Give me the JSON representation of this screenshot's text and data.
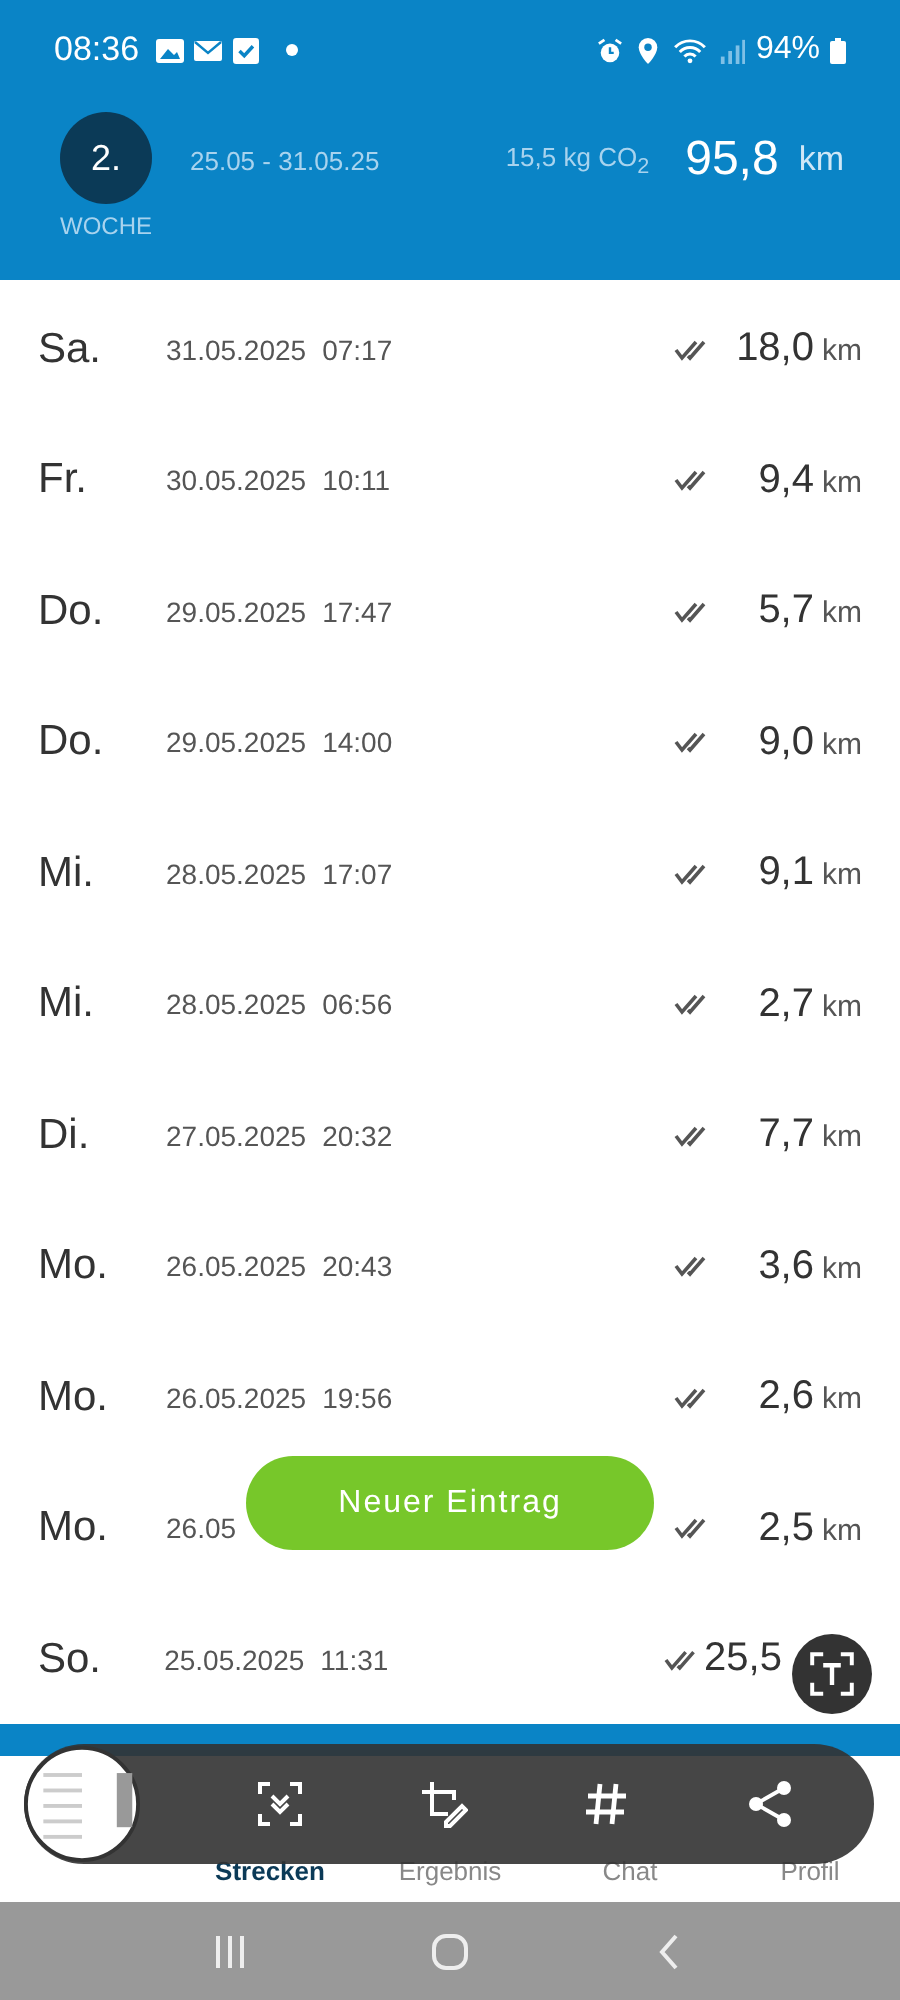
{
  "status_bar": {
    "time": "08:36",
    "battery": "94%"
  },
  "header": {
    "week_number": "2.",
    "week_label": "WOCHE",
    "range": "25.05 - 31.05.25",
    "co2": "15,5 kg CO$_{2}$",
    "total": "95,8",
    "unit": "km"
  },
  "rows": [
    {
      "day": "Sa.",
      "date": "31.05.2025",
      "time": "07:17",
      "distance": "18,0",
      "unit": "km"
    },
    {
      "day": "Fr.",
      "date": "30.05.2025",
      "time": "10:11",
      "distance": "9,4",
      "unit": "km"
    },
    {
      "day": "Do.",
      "date": "29.05.2025",
      "time": "17:47",
      "distance": "5,7",
      "unit": "km"
    },
    {
      "day": "Do.",
      "date": "29.05.2025",
      "time": "14:00",
      "distance": "9,0",
      "unit": "km"
    },
    {
      "day": "Mi.",
      "date": "28.05.2025",
      "time": "17:07",
      "distance": "9,1",
      "unit": "km"
    },
    {
      "day": "Mi.",
      "date": "28.05.2025",
      "time": "06:56",
      "distance": "2,7",
      "unit": "km"
    },
    {
      "day": "Di.",
      "date": "27.05.2025",
      "time": "20:32",
      "distance": "7,7",
      "unit": "km"
    },
    {
      "day": "Mo.",
      "date": "26.05.2025",
      "time": "20:43",
      "distance": "3,6",
      "unit": "km"
    },
    {
      "day": "Mo.",
      "date": "26.05.2025",
      "time": "19:56",
      "distance": "2,6",
      "unit": "km"
    },
    {
      "day": "Mo.",
      "date": "26.05",
      "distance": "2,5",
      "unit": "km"
    },
    {
      "day": "So.",
      "date": "25.05.2025",
      "time": "11:31",
      "distance": "25,5"
    }
  ],
  "new_entry_button": "Neuer Eintrag",
  "nav": [
    {
      "label": "Strecken",
      "selected": true
    },
    {
      "label": "Ergebnis",
      "selected": false
    },
    {
      "label": "Chat",
      "selected": false
    },
    {
      "label": "Profil",
      "selected": false
    }
  ]
}
